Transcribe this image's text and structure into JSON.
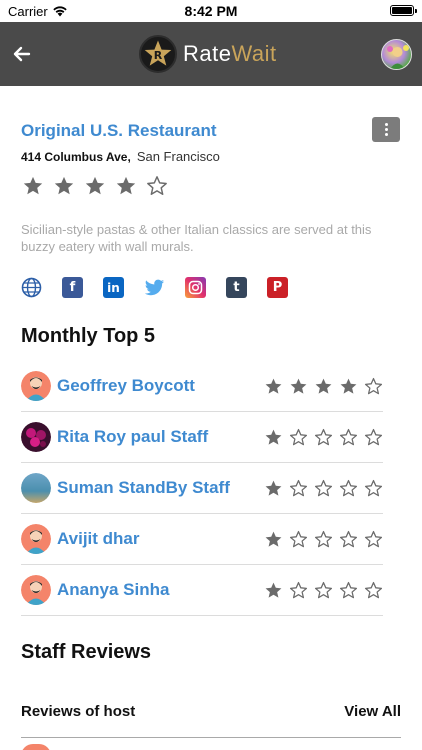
{
  "status_bar": {
    "carrier": "Carrier",
    "time": "8:42 PM"
  },
  "nav": {
    "logo_text_1": "Rate",
    "logo_text_2": "Wait",
    "logo_letter": "R",
    "back_icon": "back-arrow-icon",
    "accent_gold": "#c9a45a",
    "bar_color": "#4a4a4a"
  },
  "restaurant": {
    "name": "Original U.S. Restaurant",
    "street": "414 Columbus Ave,",
    "city": "San Francisco",
    "rating": 4,
    "rating_max": 5,
    "description": "Sicilian-style pastas & other Italian classics are served at this buzzy eatery with wall murals.",
    "socials": [
      "globe-icon",
      "facebook-icon",
      "linkedin-icon",
      "twitter-icon",
      "instagram-icon",
      "tumblr-icon",
      "pinterest-icon"
    ]
  },
  "monthly_top": {
    "title": "Monthly Top 5",
    "items": [
      {
        "name": "Geoffrey Boycott",
        "rating": 4,
        "avatar": "person-avatar"
      },
      {
        "name": "Rita Roy paul Staff",
        "rating": 1,
        "avatar": "flower-photo"
      },
      {
        "name": "Suman StandBy Staff",
        "rating": 1,
        "avatar": "landscape-photo"
      },
      {
        "name": "Avijit dhar",
        "rating": 1,
        "avatar": "person-avatar"
      },
      {
        "name": "Ananya Sinha",
        "rating": 1,
        "avatar": "person-avatar"
      }
    ]
  },
  "staff_reviews": {
    "title": "Staff Reviews",
    "tab_label": "Reviews of host",
    "view_all": "View All"
  },
  "colors": {
    "link_blue": "#3f8ad0",
    "star_gray": "#6b6b6b",
    "muted_text": "#a9a9a9"
  }
}
